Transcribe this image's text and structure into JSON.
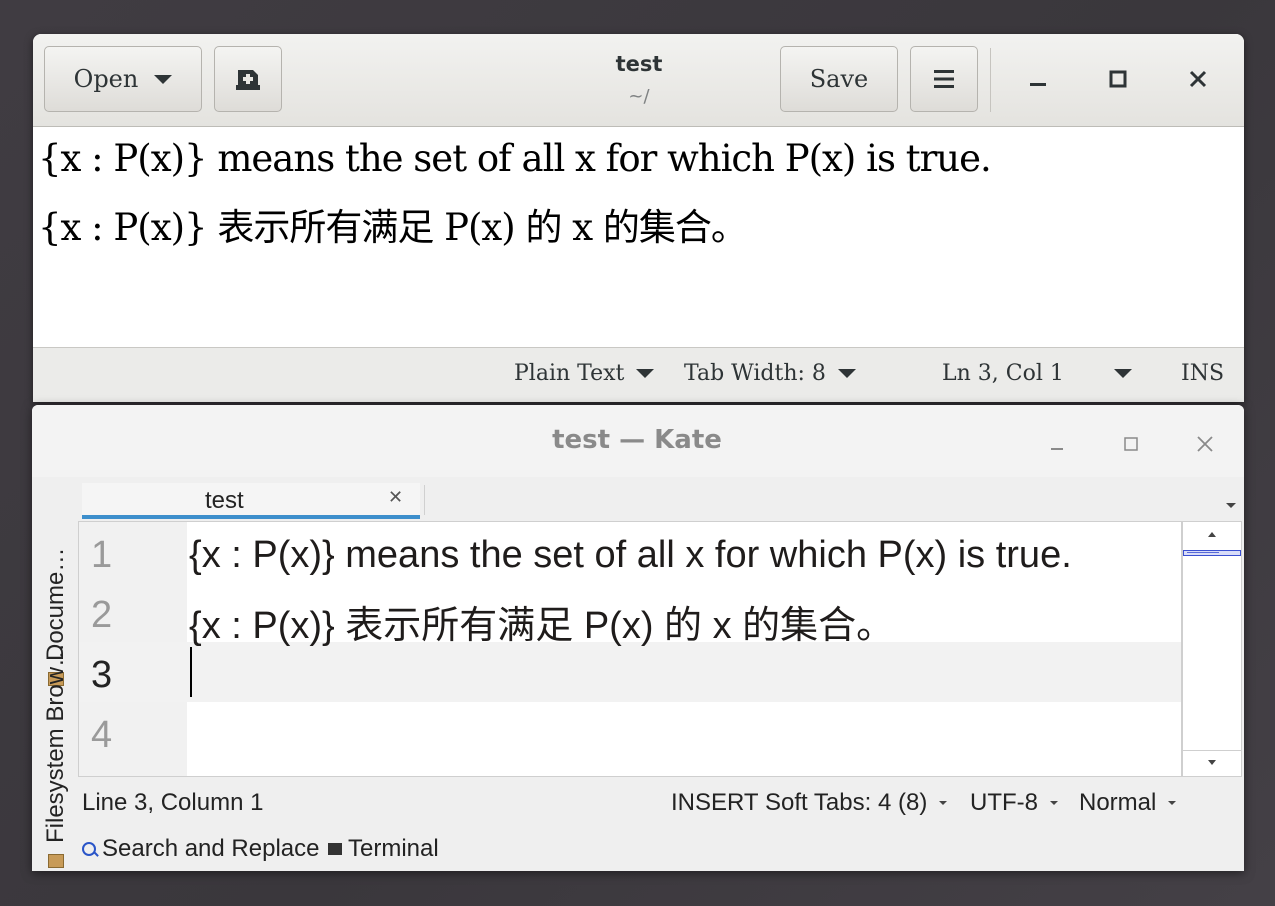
{
  "gedit": {
    "open_label": "Open",
    "save_label": "Save",
    "title": "test",
    "subtitle": "~/",
    "lines": [
      "{x : P(x)} means the set of all x for which P(x) is true.",
      "{x : P(x)} 表示所有满足 P(x) 的 x 的集合。"
    ],
    "status": {
      "language": "Plain Text",
      "tab_width": "Tab Width: 8",
      "position": "Ln 3, Col 1",
      "mode": "INS"
    }
  },
  "kate": {
    "title": "test  — Kate",
    "sidebar": {
      "documents": "Docume…",
      "filesystem": "Filesystem Brow…"
    },
    "tab_label": "test",
    "line_numbers": [
      "1",
      "2",
      "3",
      "4"
    ],
    "lines": [
      "{x : P(x)} means the set of all x for which P(x) is true.",
      "{x : P(x)} 表示所有满足 P(x) 的 x 的集合。",
      "",
      ""
    ],
    "status": {
      "position": "Line 3, Column 1",
      "mode": "INSERT",
      "tabs": "Soft Tabs: 4 (8)",
      "encoding": "UTF-8",
      "input_mode": "Normal"
    },
    "tools": {
      "search": "Search and Replace",
      "terminal": "Terminal"
    }
  },
  "colors": {
    "desktop": "#3c393e",
    "kate_accent": "#3d8fcc"
  }
}
